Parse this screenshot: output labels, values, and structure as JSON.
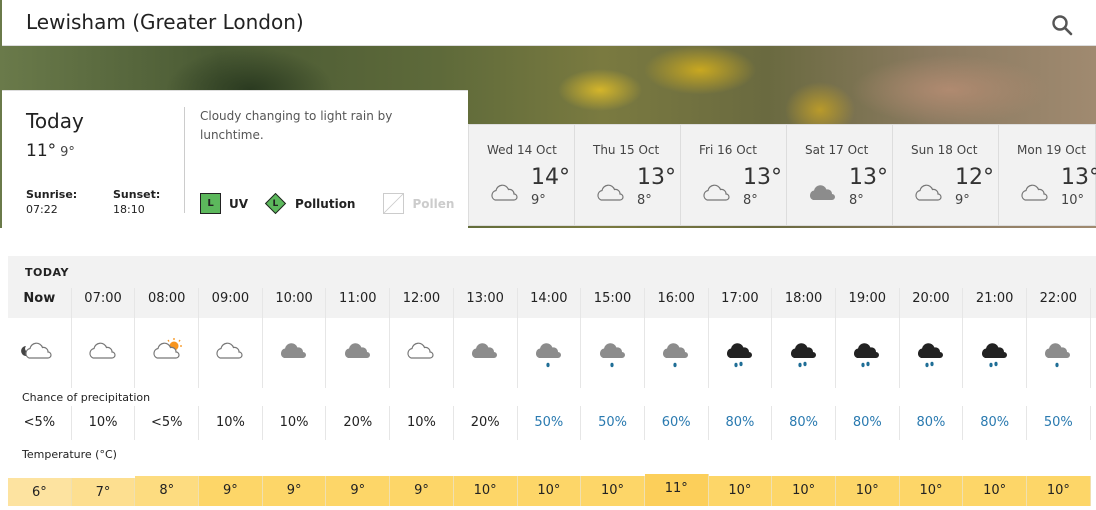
{
  "header": {
    "location": "Lewisham (Greater London)",
    "search_icon": "search-icon"
  },
  "today": {
    "title": "Today",
    "high": "11°",
    "low": "9°",
    "sunrise_label": "Sunrise:",
    "sunrise": "07:22",
    "sunset_label": "Sunset:",
    "sunset": "18:10",
    "summary": "Cloudy changing to light rain by lunchtime.",
    "uv_level": "L",
    "uv_label": "UV",
    "pollution_level": "L",
    "pollution_label": "Pollution",
    "pollen_label": "Pollen",
    "badge_color": "#5cb85c"
  },
  "days": [
    {
      "name": "Wed 14 Oct",
      "icon": "cloud-outline",
      "high": "14°",
      "low": "9°"
    },
    {
      "name": "Thu 15 Oct",
      "icon": "cloud-outline",
      "high": "13°",
      "low": "8°"
    },
    {
      "name": "Fri 16 Oct",
      "icon": "cloud-outline",
      "high": "13°",
      "low": "8°"
    },
    {
      "name": "Sat 17 Oct",
      "icon": "cloud-grey",
      "high": "13°",
      "low": "8°"
    },
    {
      "name": "Sun 18 Oct",
      "icon": "cloud-outline",
      "high": "12°",
      "low": "9°"
    },
    {
      "name": "Mon 19 Oct",
      "icon": "cloud-outline",
      "high": "13°",
      "low": "10°"
    }
  ],
  "hourly": {
    "section_label": "TODAY",
    "precip_label": "Chance of precipitation",
    "temp_label": "Temperature (°C)",
    "hours": [
      {
        "time": "Now",
        "icon": "cloud-moon",
        "precip": "<5%",
        "temp": "6°"
      },
      {
        "time": "07:00",
        "icon": "cloud-outline",
        "precip": "10%",
        "temp": "7°"
      },
      {
        "time": "08:00",
        "icon": "cloud-sun",
        "precip": "<5%",
        "temp": "8°"
      },
      {
        "time": "09:00",
        "icon": "cloud-outline",
        "precip": "10%",
        "temp": "9°"
      },
      {
        "time": "10:00",
        "icon": "cloud-grey",
        "precip": "10%",
        "temp": "9°"
      },
      {
        "time": "11:00",
        "icon": "cloud-grey",
        "precip": "20%",
        "temp": "9°"
      },
      {
        "time": "12:00",
        "icon": "cloud-outline",
        "precip": "10%",
        "temp": "9°"
      },
      {
        "time": "13:00",
        "icon": "cloud-grey",
        "precip": "20%",
        "temp": "10°"
      },
      {
        "time": "14:00",
        "icon": "light-rain",
        "precip": "50%",
        "temp": "10°"
      },
      {
        "time": "15:00",
        "icon": "light-rain",
        "precip": "50%",
        "temp": "10°"
      },
      {
        "time": "16:00",
        "icon": "light-rain",
        "precip": "60%",
        "temp": "11°"
      },
      {
        "time": "17:00",
        "icon": "heavy-rain",
        "precip": "80%",
        "temp": "10°"
      },
      {
        "time": "18:00",
        "icon": "heavy-rain",
        "precip": "80%",
        "temp": "10°"
      },
      {
        "time": "19:00",
        "icon": "heavy-rain",
        "precip": "80%",
        "temp": "10°"
      },
      {
        "time": "20:00",
        "icon": "heavy-rain",
        "precip": "80%",
        "temp": "10°"
      },
      {
        "time": "21:00",
        "icon": "heavy-rain",
        "precip": "80%",
        "temp": "10°"
      },
      {
        "time": "22:00",
        "icon": "light-rain",
        "precip": "50%",
        "temp": "10°"
      }
    ]
  }
}
